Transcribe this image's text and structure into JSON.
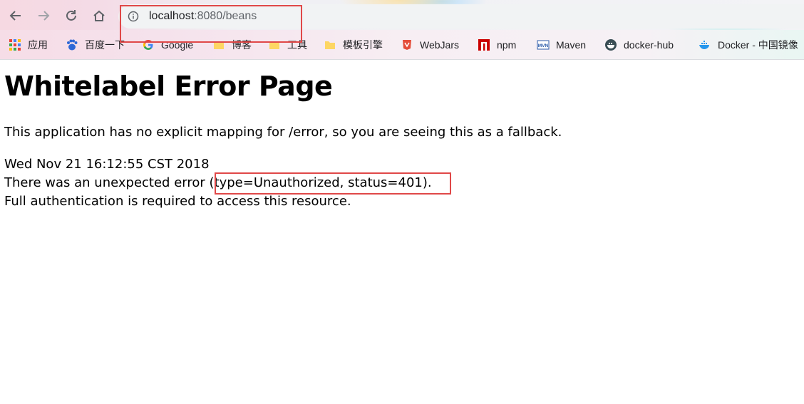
{
  "browser": {
    "url_host": "localhost",
    "url_rest": ":8080/beans",
    "accent_color": "#e04848"
  },
  "bookmarks": [
    {
      "label": "应用",
      "icon": "apps-grid-icon"
    },
    {
      "label": "百度一下",
      "icon": "baidu-paw-icon"
    },
    {
      "label": "Google",
      "icon": "google-g-icon"
    },
    {
      "label": "博客",
      "icon": "folder-icon"
    },
    {
      "label": "工具",
      "icon": "folder-icon"
    },
    {
      "label": "模板引擎",
      "icon": "folder-icon"
    },
    {
      "label": "WebJars",
      "icon": "webjars-icon"
    },
    {
      "label": "npm",
      "icon": "npm-icon"
    },
    {
      "label": "Maven",
      "icon": "maven-icon"
    },
    {
      "label": "docker-hub",
      "icon": "docker-hub-icon"
    },
    {
      "label": "Docker - 中国镜像",
      "icon": "docker-whale-icon"
    }
  ],
  "page": {
    "title": "Whitelabel Error Page",
    "description": "This application has no explicit mapping for /error, so you are seeing this as a fallback.",
    "timestamp": "Wed Nov 21 16:12:55 CST 2018",
    "error_prefix": "There was an unexpected error ",
    "error_detail": "(type=Unauthorized, status=401).",
    "message": "Full authentication is required to access this resource."
  }
}
